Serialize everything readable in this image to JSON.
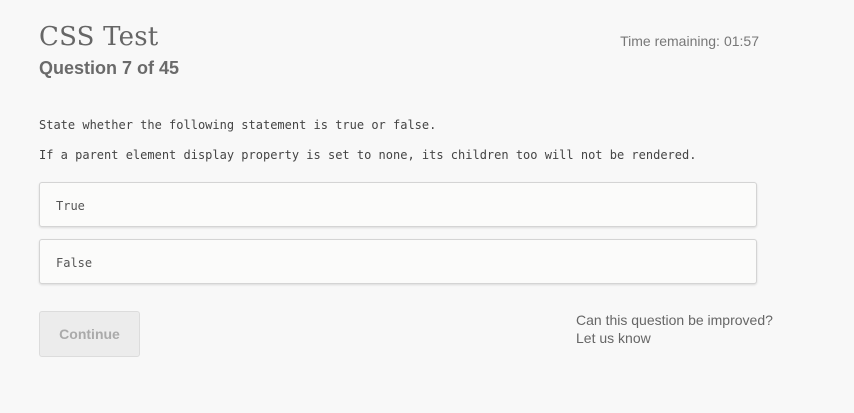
{
  "header": {
    "title": "CSS Test",
    "question_counter": "Question 7 of 45",
    "timer_label": "Time remaining:",
    "timer_value": "01:57"
  },
  "question": {
    "instruction": "State whether the following statement is true or false.",
    "statement": "If a parent element display property is set to none, its children too will not be rendered.",
    "options": [
      {
        "label": "True"
      },
      {
        "label": "False"
      }
    ]
  },
  "footer": {
    "continue_label": "Continue",
    "feedback_prompt": "Can this question be improved?",
    "feedback_link": "Let us know"
  }
}
